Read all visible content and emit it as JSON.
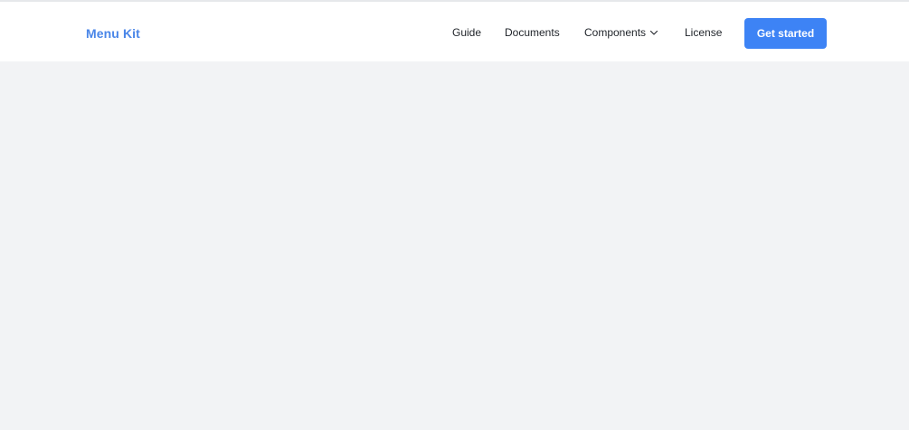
{
  "header": {
    "brand": "Menu Kit",
    "brand_color": "#4a86e8",
    "nav": {
      "guide": "Guide",
      "documents": "Documents",
      "components": "Components",
      "license": "License"
    },
    "components_icon": "chevron-down-icon",
    "cta_label": "Get started",
    "cta_color": "#3d83f5"
  },
  "page": {
    "background_color": "#f2f3f5"
  }
}
